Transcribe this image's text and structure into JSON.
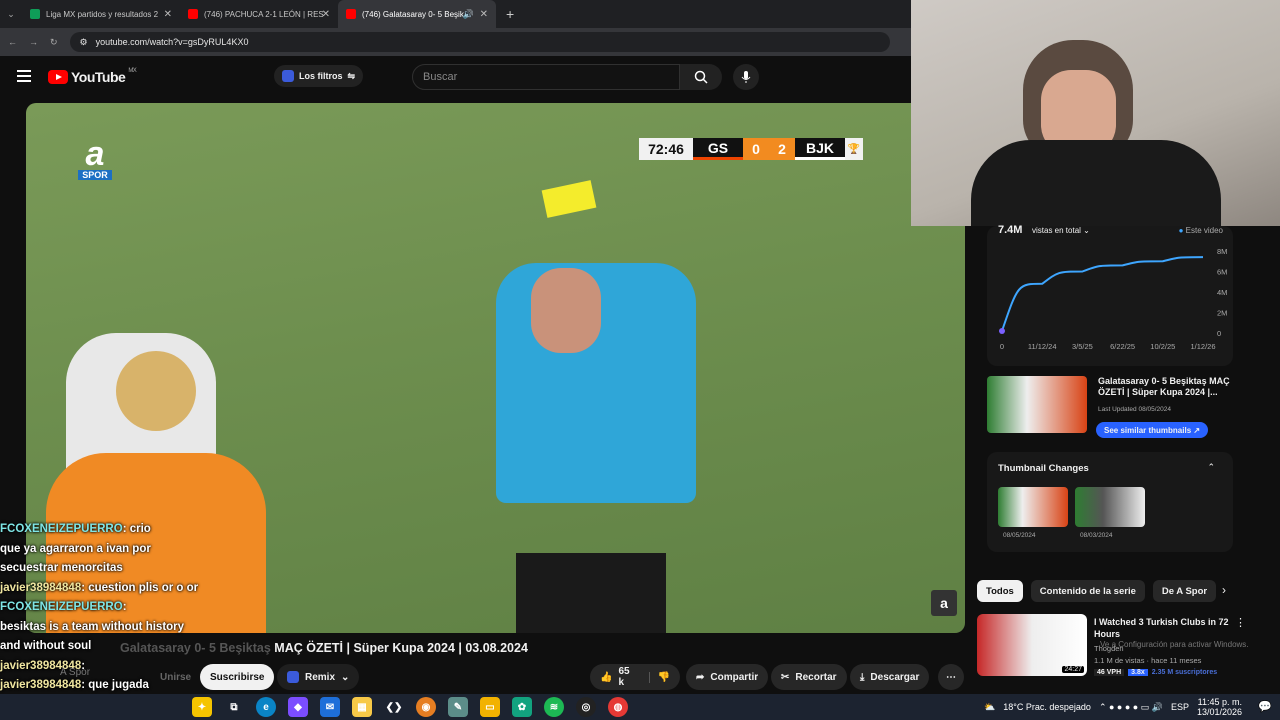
{
  "browser": {
    "tabs": [
      {
        "label": "Liga MX partidos y resultados 2",
        "color": "#0f9d58"
      },
      {
        "label": "(746) PACHUCA 2-1 LEÓN | RES",
        "color": "#ff0000"
      },
      {
        "label": "(746) Galatasaray 0- 5 Beşik",
        "color": "#ff0000"
      }
    ],
    "url": "youtube.com/watch?v=gsDyRUL4KX0"
  },
  "youtube": {
    "logo_text": "YouTube",
    "region": "MX",
    "filters_label": "Los filtros",
    "search_placeholder": "Buscar"
  },
  "video": {
    "channel_logo": "a",
    "channel_logo_sub": "SPOR",
    "score": {
      "time": "72:46",
      "home": "GS",
      "home_score": "0",
      "away_score": "2",
      "away": "BJK"
    },
    "watermark": "a",
    "title": "MAÇ ÖZETİ | Süper Kupa 2024 | 03.08.2024",
    "title_partial": "Galatasaray 0- 5 Beşiktaş"
  },
  "chat": [
    {
      "user": "FCOXENEIZEPUERRO",
      "text": ": crio",
      "type": "user2"
    },
    {
      "user": "",
      "text": "que ya agarraron a ivan por secuestrar menorcitas",
      "type": "plain"
    },
    {
      "user": "javier38984848",
      "text": ": cuestion plis or o or",
      "type": "user"
    },
    {
      "user": "FCOXENEIZEPUERRO",
      "text": ":",
      "type": "user2"
    },
    {
      "user": "",
      "text": "besiktas is a team without history and without soul",
      "type": "plain"
    },
    {
      "user": "javier38984848",
      "text": ":",
      "type": "user"
    },
    {
      "user": "javier38984848",
      "text": ": que jugada",
      "type": "user"
    }
  ],
  "actions": {
    "channel": "A Spor",
    "join": "Unirse",
    "subscribe": "Suscribirse",
    "remix": "Remix",
    "likes": "65 k",
    "share": "Compartir",
    "clip": "Recortar",
    "download": "Descargar"
  },
  "stats": {
    "views": "7.4M",
    "views_label": "vistas en total",
    "legend": "Este video",
    "y_ticks": [
      "8M",
      "6M",
      "4M",
      "2M",
      "0"
    ],
    "x_ticks": [
      "0",
      "11/12/24",
      "3/5/25",
      "6/22/25",
      "10/2/25",
      "1/12/26"
    ]
  },
  "chart_data": {
    "type": "line",
    "series": [
      {
        "name": "Este video",
        "x": [
          "0",
          "11/12/24",
          "3/5/25",
          "6/22/25",
          "10/2/25",
          "1/12/26"
        ],
        "values": [
          0.2,
          4.8,
          6.0,
          6.6,
          7.0,
          7.4
        ]
      }
    ],
    "ylim": [
      0,
      8
    ],
    "color": "#3ea6ff"
  },
  "related": {
    "title": "Galatasaray 0- 5 Beşiktaş MAÇ ÖZETİ | Süper Kupa 2024 |...",
    "updated": "Last Updated 08/05/2024",
    "similar_button": "See similar thumbnails"
  },
  "thumb_changes": {
    "title": "Thumbnail Changes",
    "dates": [
      "08/05/2024",
      "08/03/2024"
    ]
  },
  "chips": [
    "Todos",
    "Contenido de la serie",
    "De A Spor"
  ],
  "rec": {
    "title": "I Watched 3 Turkish Clubs in 72 Hours",
    "channel": "Thogden",
    "meta": "1.1 M de vistas · hace 11 meses",
    "duration": "24:27",
    "vph": "46 VPH",
    "mult": "3.8x",
    "subs": "2.35 M suscriptores",
    "activate_windows": "Ve a Configuración para activar Windows."
  },
  "taskbar": {
    "weather": "18°C  Prac. despejado",
    "lang": "ESP",
    "time": "11:45 p. m.",
    "date": "13/01/2026"
  }
}
